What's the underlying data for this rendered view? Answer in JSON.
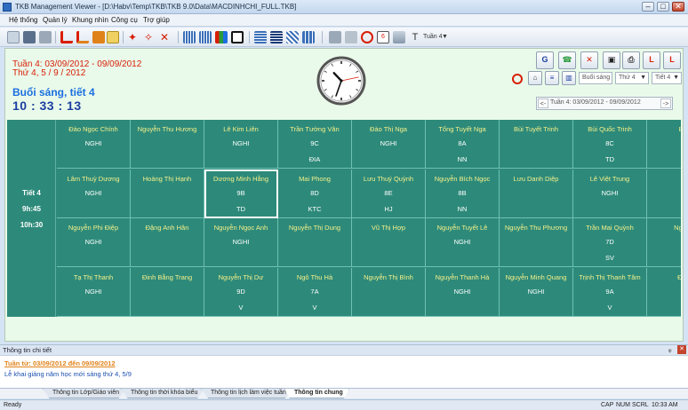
{
  "window": {
    "title": "TKB Management Viewer - [D:\\Habv\\Temp\\TKB\\TKB 9.0\\Data\\MACDINHCHI_FULL.TKB]",
    "min_glyph": "–",
    "max_glyph": "□",
    "close_glyph": "✕"
  },
  "menu": [
    "Hệ thống",
    "Quản lý",
    "Khung nhìn",
    "Công cụ",
    "Trợ giúp"
  ],
  "toolbar": {
    "week_label": "Tuần 4"
  },
  "info": {
    "week_range": "Tuần 4: 03/09/2012 - 09/09/2012",
    "week_days": "Thứ 4, 5 / 9 / 2012",
    "session": "Buổi sáng, tiết 4",
    "time": "10 : 33 : 13"
  },
  "clock": {
    "hours": 10,
    "minutes": 33,
    "seconds": 13
  },
  "right_controls": {
    "session_select": "Buổi sáng",
    "day_select": "Thứ 4",
    "period_select": "Tiết 4",
    "week_nav": "Tuần 4: 03/09/2012 - 09/09/2012",
    "prev": "<-",
    "next": "->",
    "arrow": "▼"
  },
  "period": {
    "label": "Tiết 4",
    "start": "9h:45",
    "end": "10h:30"
  },
  "grid": [
    [
      {
        "name": "Đào Ngọc Chính",
        "l1": "NGHI",
        "l2": ""
      },
      {
        "name": "Nguyễn Thu Hương",
        "l1": "",
        "l2": ""
      },
      {
        "name": "Lê Kim Liên",
        "l1": "NGHI",
        "l2": ""
      },
      {
        "name": "Trần Tường Vân",
        "l1": "9C",
        "l2": "ĐIA"
      },
      {
        "name": "Đào Thị Nga",
        "l1": "NGHI",
        "l2": ""
      },
      {
        "name": "Tống Tuyết Nga",
        "l1": "8A",
        "l2": "NN"
      },
      {
        "name": "Bùi Tuyết Trinh",
        "l1": "",
        "l2": ""
      },
      {
        "name": "Bùi Quốc Trinh",
        "l1": "8C",
        "l2": "TD"
      },
      {
        "name": "Bùi",
        "l1": "",
        "l2": ""
      }
    ],
    [
      {
        "name": "Lâm Thuỳ Dương",
        "l1": "NGHI",
        "l2": ""
      },
      {
        "name": "Hoàng Thị Hạnh",
        "l1": "",
        "l2": ""
      },
      {
        "name": "Dương Minh Hằng",
        "l1": "9B",
        "l2": "TD"
      },
      {
        "name": "Mai Phong",
        "l1": "8D",
        "l2": "KTC"
      },
      {
        "name": "Lưu Thuý Quỳnh",
        "l1": "8E",
        "l2": "HJ"
      },
      {
        "name": "Nguyễn Bích Ngọc",
        "l1": "8B",
        "l2": "NN"
      },
      {
        "name": "Lưu Danh Diệp",
        "l1": "",
        "l2": ""
      },
      {
        "name": "Lê Việt Trung",
        "l1": "NGHI",
        "l2": ""
      },
      {
        "name": "",
        "l1": "",
        "l2": ""
      }
    ],
    [
      {
        "name": "Nguyễn Phi Điệp",
        "l1": "NGHI",
        "l2": ""
      },
      {
        "name": "Đặng Anh Hân",
        "l1": "",
        "l2": ""
      },
      {
        "name": "Nguyễn Ngọc Anh",
        "l1": "NGHI",
        "l2": ""
      },
      {
        "name": "Nguyễn Thị Dung",
        "l1": "",
        "l2": ""
      },
      {
        "name": "Vũ Thị Hợp",
        "l1": "",
        "l2": ""
      },
      {
        "name": "Nguyễn Tuyết Lê",
        "l1": "NGHI",
        "l2": ""
      },
      {
        "name": "Nguyễn Thu Phương",
        "l1": "",
        "l2": ""
      },
      {
        "name": "Trần Mai Quỳnh",
        "l1": "7D",
        "l2": "SV"
      },
      {
        "name": "Nguyễ",
        "l1": "",
        "l2": ""
      }
    ],
    [
      {
        "name": "Tạ Thị Thanh",
        "l1": "NGHI",
        "l2": ""
      },
      {
        "name": "Đinh Bằng Trang",
        "l1": "",
        "l2": ""
      },
      {
        "name": "Nguyễn Thị Dư",
        "l1": "9D",
        "l2": "V"
      },
      {
        "name": "Ngô Thu Hà",
        "l1": "7A",
        "l2": "V"
      },
      {
        "name": "Nguyễn Thị Bình",
        "l1": "",
        "l2": ""
      },
      {
        "name": "Nguyễn Thanh Hà",
        "l1": "NGHI",
        "l2": ""
      },
      {
        "name": "Nguyễn Minh Quang",
        "l1": "NGHI",
        "l2": ""
      },
      {
        "name": "Trịnh Thị Thanh Tâm",
        "l1": "9A",
        "l2": "V"
      },
      {
        "name": "Đoà",
        "l1": "",
        "l2": ""
      }
    ]
  ],
  "detail_panel": {
    "title": "Thông tin chi tiết",
    "link": "Tuần từ: 03/09/2012 đến 09/09/2012",
    "message": "Lễ khai giảng năm học mới sáng thứ 4, 5/9",
    "pin_glyph": "ᵩ",
    "close_glyph": "✕"
  },
  "tabs": [
    "Thông tin Lớp/Giáo viên",
    "Thông tin thời khóa biểu",
    "Thông tin lịch làm việc tuần",
    "Thông tin chung"
  ],
  "status": {
    "left": "Ready",
    "caps": "CAP",
    "num": "NUM",
    "scrl": "SCRL",
    "clock": "10:33 AM"
  },
  "colors": {
    "grid_bg": "#2d8a7a",
    "name_text": "#f5f08a",
    "accent_red": "#d81e06",
    "accent_blue": "#1b6fe0"
  }
}
